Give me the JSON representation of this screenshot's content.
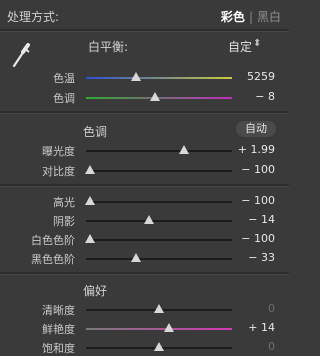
{
  "header": {
    "title": "处理方式:",
    "mode_color": "彩色",
    "separator": "|",
    "mode_bw": "黑白"
  },
  "white_balance": {
    "label": "白平衡:",
    "value": "自定",
    "chevron": "⬍"
  },
  "sliders_wb": [
    {
      "label": "色温",
      "value": "5259",
      "position": 0.34
    },
    {
      "label": "色调",
      "value": "− 8",
      "position": 0.47
    }
  ],
  "tone": {
    "title": "色调",
    "auto_label": "自动"
  },
  "sliders_tone": [
    {
      "label": "曝光度",
      "value": "+ 1.99",
      "position": 0.67
    },
    {
      "label": "对比度",
      "value": "− 100",
      "position": 0.03
    }
  ],
  "sliders_tone2": [
    {
      "label": "高光",
      "value": "− 100",
      "position": 0.03
    },
    {
      "label": "阴影",
      "value": "− 14",
      "position": 0.43
    },
    {
      "label": "白色色阶",
      "value": "− 100",
      "position": 0.03
    },
    {
      "label": "黑色色阶",
      "value": "− 33",
      "position": 0.34
    }
  ],
  "presence": {
    "title": "偏好"
  },
  "sliders_presence": [
    {
      "label": "清晰度",
      "value": "0",
      "position": 0.5,
      "dim": true
    },
    {
      "label": "鲜艳度",
      "value": "+ 14",
      "position": 0.57,
      "dim": false
    },
    {
      "label": "饱和度",
      "value": "0",
      "position": 0.5,
      "dim": true
    }
  ],
  "colors": {
    "temp_gradient": [
      "#2f4fd0",
      "#c8c840"
    ],
    "tint_gradient": [
      "#2fa832",
      "#c02fc0"
    ],
    "vibrance_gradient": [
      "#7a7a7a",
      "#d23ab4"
    ]
  }
}
